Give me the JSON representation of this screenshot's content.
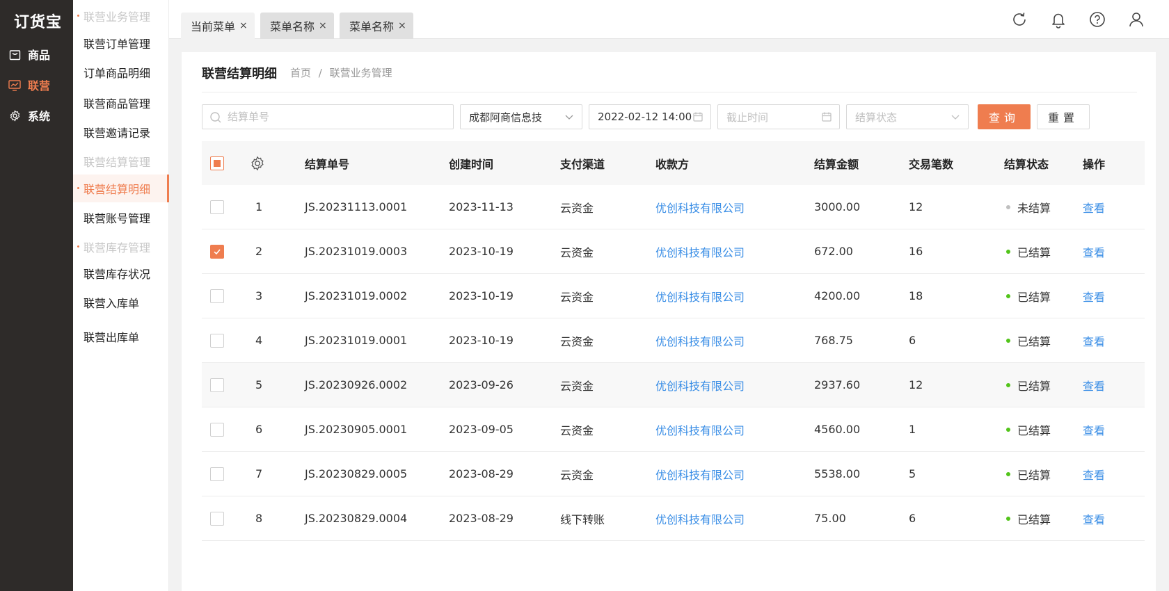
{
  "app": {
    "logo": "订货宝"
  },
  "rail": {
    "items": [
      {
        "label": "商品",
        "icon": "bag-icon",
        "active": false
      },
      {
        "label": "联营",
        "icon": "chart-icon",
        "active": true
      },
      {
        "label": "系统",
        "icon": "gear-icon",
        "active": false
      }
    ]
  },
  "submenu": {
    "group1": "联营业务管理",
    "item1": "联营订单管理",
    "item2": "订单商品明细",
    "item3": "联营商品管理",
    "item4": "联营邀请记录",
    "group2": "联营结算管理",
    "item5": "联营结算明细",
    "item6": "联营账号管理",
    "group3": "联营库存管理",
    "item7": "联营库存状况",
    "item8": "联营入库单",
    "item9": "联营出库单"
  },
  "tabs": [
    {
      "label": "当前菜单",
      "close": "×"
    },
    {
      "label": "菜单名称",
      "close": "×"
    },
    {
      "label": "菜单名称",
      "close": "×"
    }
  ],
  "header": {
    "icons": [
      "refresh-icon",
      "bell-icon",
      "help-icon",
      "user-icon"
    ]
  },
  "page": {
    "title": "联营结算明细",
    "breadcrumb_home": "首页",
    "breadcrumb_sep": "/",
    "breadcrumb_current": "联营业务管理"
  },
  "filters": {
    "search_placeholder": "结算单号",
    "company_value": "成都阿商信息技",
    "start_time_value": "2022-02-12 14:00",
    "end_time_placeholder": "截止时间",
    "status_placeholder": "结算状态",
    "query_label": "查询",
    "reset_label": "重置"
  },
  "table": {
    "headers": {
      "no": "结算单号",
      "created": "创建时间",
      "channel": "支付渠道",
      "payee": "收款方",
      "amount": "结算金额",
      "count": "交易笔数",
      "status": "结算状态",
      "action": "操作"
    },
    "rows": [
      {
        "idx": "1",
        "no": "JS.20231113.0001",
        "created": "2023-11-13",
        "channel": "云资金",
        "payee": "优创科技有限公司",
        "amount": "3000.00",
        "count": "12",
        "status": "未结算",
        "action": "查看",
        "checked": false
      },
      {
        "idx": "2",
        "no": "JS.20231019.0003",
        "created": "2023-10-19",
        "channel": "云资金",
        "payee": "优创科技有限公司",
        "amount": "672.00",
        "count": "16",
        "status": "已结算",
        "action": "查看",
        "checked": true
      },
      {
        "idx": "3",
        "no": "JS.20231019.0002",
        "created": "2023-10-19",
        "channel": "云资金",
        "payee": "优创科技有限公司",
        "amount": "4200.00",
        "count": "18",
        "status": "已结算",
        "action": "查看",
        "checked": false
      },
      {
        "idx": "4",
        "no": "JS.20231019.0001",
        "created": "2023-10-19",
        "channel": "云资金",
        "payee": "优创科技有限公司",
        "amount": "768.75",
        "count": "6",
        "status": "已结算",
        "action": "查看",
        "checked": false
      },
      {
        "idx": "5",
        "no": "JS.20230926.0002",
        "created": "2023-09-26",
        "channel": "云资金",
        "payee": "优创科技有限公司",
        "amount": "2937.60",
        "count": "12",
        "status": "已结算",
        "action": "查看",
        "checked": false
      },
      {
        "idx": "6",
        "no": "JS.20230905.0001",
        "created": "2023-09-05",
        "channel": "云资金",
        "payee": "优创科技有限公司",
        "amount": "4560.00",
        "count": "1",
        "status": "已结算",
        "action": "查看",
        "checked": false
      },
      {
        "idx": "7",
        "no": "JS.20230829.0005",
        "created": "2023-08-29",
        "channel": "云资金",
        "payee": "优创科技有限公司",
        "amount": "5538.00",
        "count": "5",
        "status": "已结算",
        "action": "查看",
        "checked": false
      },
      {
        "idx": "8",
        "no": "JS.20230829.0004",
        "created": "2023-08-29",
        "channel": "线下转账",
        "payee": "优创科技有限公司",
        "amount": "75.00",
        "count": "6",
        "status": "已结算",
        "action": "查看",
        "checked": false
      }
    ]
  },
  "colors": {
    "accent": "#ef7d4f",
    "link": "#3a8ee6",
    "settled": "#52c41a",
    "unsettled": "#bfbfbf",
    "rail_bg": "#2e2b29"
  }
}
